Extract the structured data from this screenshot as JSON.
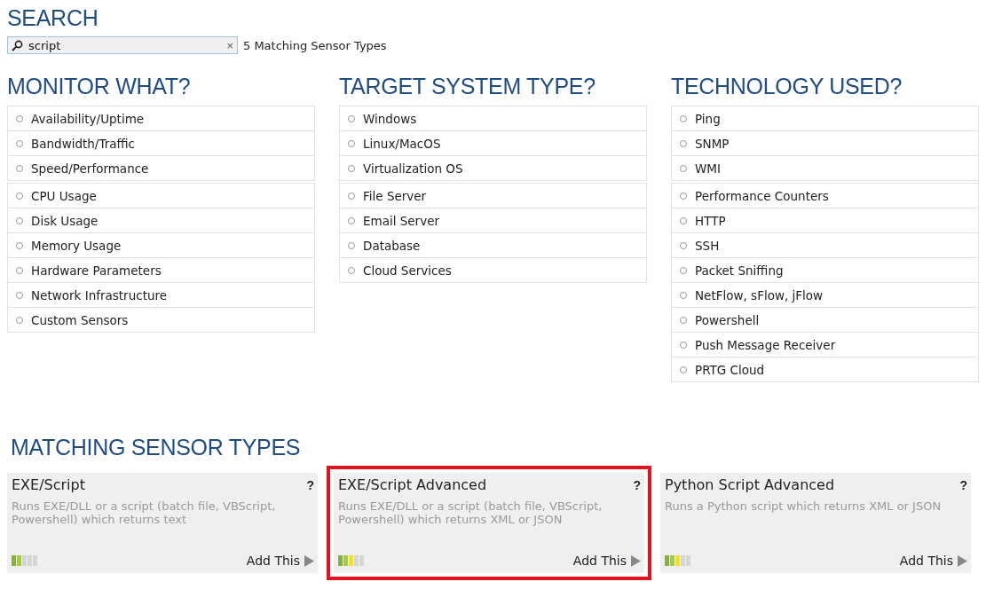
{
  "search": {
    "heading": "SEARCH",
    "value": "script",
    "clear": "×",
    "result_count": "5 Matching Sensor Types"
  },
  "filters": [
    {
      "heading": "MONITOR WHAT?",
      "groups": [
        [
          "Availability/Uptime",
          "Bandwidth/Traffic",
          "Speed/Performance"
        ],
        [
          "CPU Usage",
          "Disk Usage",
          "Memory Usage",
          "Hardware Parameters",
          "Network Infrastructure",
          "Custom Sensors"
        ]
      ]
    },
    {
      "heading": "TARGET SYSTEM TYPE?",
      "groups": [
        [
          "Windows",
          "Linux/MacOS",
          "Virtualization OS"
        ],
        [
          "File Server",
          "Email Server",
          "Database",
          "Cloud Services"
        ]
      ]
    },
    {
      "heading": "TECHNOLOGY USED?",
      "groups": [
        [
          "Ping",
          "SNMP",
          "WMI"
        ],
        [
          "Performance Counters",
          "HTTP",
          "SSH",
          "Packet Sniffing",
          "NetFlow, sFlow, jFlow",
          "Powershell",
          "Push Message Receiver",
          "PRTG Cloud"
        ]
      ]
    }
  ],
  "matches": {
    "heading": "MATCHING SENSOR TYPES",
    "cards": [
      {
        "title": "EXE/Script",
        "help": "?",
        "description": "Runs EXE/DLL or a script (batch file, VBScript, Powershell) which returns text",
        "level": 0.4,
        "action": "Add This",
        "highlighted": false
      },
      {
        "title": "EXE/Script Advanced",
        "help": "?",
        "description": "Runs EXE/DLL or a script (batch file, VBScript, Powershell) which returns XML or JSON",
        "level": 0.6,
        "action": "Add This",
        "highlighted": true
      },
      {
        "title": "Python Script Advanced",
        "help": "?",
        "description": "Runs a Python script which returns XML or JSON",
        "level": 0.6,
        "action": "Add This",
        "highlighted": false
      }
    ]
  }
}
